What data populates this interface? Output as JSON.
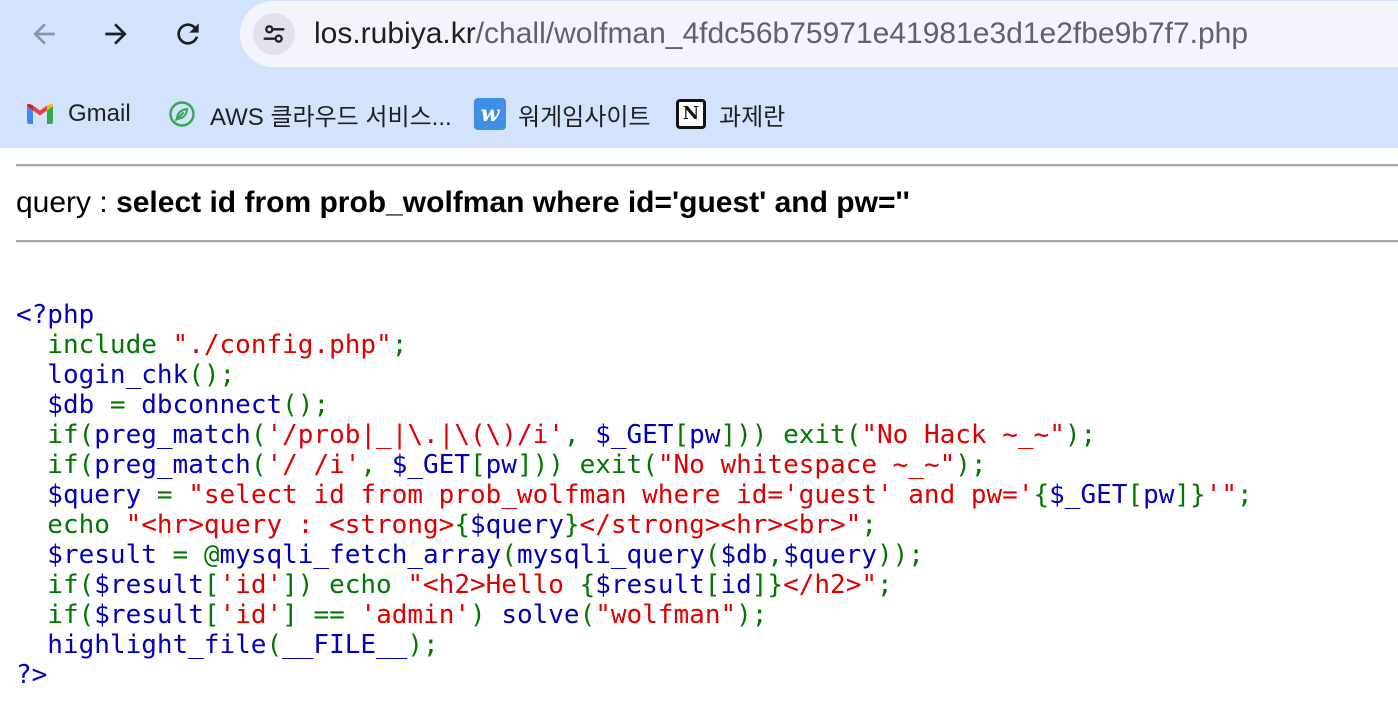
{
  "browser": {
    "nav": {
      "back_icon": "arrow-back-icon",
      "forward_icon": "arrow-forward-icon",
      "reload_icon": "reload-icon"
    },
    "omnibox": {
      "site_info_icon": "tune-icon",
      "url_host": "los.rubiya.kr",
      "url_path": "/chall/wolfman_4fdc56b75971e41981e3d1e2fbe9b7f7.php"
    },
    "bookmarks": [
      {
        "label": "Gmail",
        "icon": "gmail-icon"
      },
      {
        "label": "AWS 클라우드 서비스...",
        "icon": "aws-leaf-icon"
      },
      {
        "label": "워게임사이트",
        "icon": "wargame-w-icon",
        "icon_letter": "w"
      },
      {
        "label": "과제란",
        "icon": "notion-icon",
        "icon_letter": "N"
      }
    ]
  },
  "page": {
    "query_label": "query : ",
    "query_sql": "select id from prob_wolfman where id='guest' and pw=''",
    "source": {
      "lines": [
        [
          {
            "t": "<?php",
            "k": "default"
          }
        ],
        [
          {
            "t": "  include ",
            "k": "keyword"
          },
          {
            "t": "\"./config.php\"",
            "k": "string"
          },
          {
            "t": ";",
            "k": "keyword"
          }
        ],
        [
          {
            "t": "  login_chk",
            "k": "default"
          },
          {
            "t": "();",
            "k": "keyword"
          }
        ],
        [
          {
            "t": "  $db",
            "k": "default"
          },
          {
            "t": " = ",
            "k": "keyword"
          },
          {
            "t": "dbconnect",
            "k": "default"
          },
          {
            "t": "();",
            "k": "keyword"
          }
        ],
        [
          {
            "t": "  if(",
            "k": "keyword"
          },
          {
            "t": "preg_match",
            "k": "default"
          },
          {
            "t": "(",
            "k": "keyword"
          },
          {
            "t": "'/prob|_|\\.|\\(\\)/i'",
            "k": "string"
          },
          {
            "t": ", ",
            "k": "keyword"
          },
          {
            "t": "$_GET",
            "k": "default"
          },
          {
            "t": "[",
            "k": "keyword"
          },
          {
            "t": "pw",
            "k": "default"
          },
          {
            "t": "])) exit(",
            "k": "keyword"
          },
          {
            "t": "\"No Hack ~_~\"",
            "k": "string"
          },
          {
            "t": ");",
            "k": "keyword"
          }
        ],
        [
          {
            "t": "  if(",
            "k": "keyword"
          },
          {
            "t": "preg_match",
            "k": "default"
          },
          {
            "t": "(",
            "k": "keyword"
          },
          {
            "t": "'/ /i'",
            "k": "string"
          },
          {
            "t": ", ",
            "k": "keyword"
          },
          {
            "t": "$_GET",
            "k": "default"
          },
          {
            "t": "[",
            "k": "keyword"
          },
          {
            "t": "pw",
            "k": "default"
          },
          {
            "t": "])) exit(",
            "k": "keyword"
          },
          {
            "t": "\"No whitespace ~_~\"",
            "k": "string"
          },
          {
            "t": ");",
            "k": "keyword"
          }
        ],
        [
          {
            "t": "  $query",
            "k": "default"
          },
          {
            "t": " = ",
            "k": "keyword"
          },
          {
            "t": "\"select id from prob_wolfman where id='guest' and pw='",
            "k": "string"
          },
          {
            "t": "{",
            "k": "keyword"
          },
          {
            "t": "$_GET",
            "k": "default"
          },
          {
            "t": "[",
            "k": "keyword"
          },
          {
            "t": "pw",
            "k": "default"
          },
          {
            "t": "]}",
            "k": "keyword"
          },
          {
            "t": "'\"",
            "k": "string"
          },
          {
            "t": ";",
            "k": "keyword"
          }
        ],
        [
          {
            "t": "  echo ",
            "k": "keyword"
          },
          {
            "t": "\"<hr>query : <strong>",
            "k": "string"
          },
          {
            "t": "{",
            "k": "keyword"
          },
          {
            "t": "$query",
            "k": "default"
          },
          {
            "t": "}",
            "k": "keyword"
          },
          {
            "t": "</strong><hr><br>\"",
            "k": "string"
          },
          {
            "t": ";",
            "k": "keyword"
          }
        ],
        [
          {
            "t": "  $result",
            "k": "default"
          },
          {
            "t": " = @",
            "k": "keyword"
          },
          {
            "t": "mysqli_fetch_array",
            "k": "default"
          },
          {
            "t": "(",
            "k": "keyword"
          },
          {
            "t": "mysqli_query",
            "k": "default"
          },
          {
            "t": "(",
            "k": "keyword"
          },
          {
            "t": "$db",
            "k": "default"
          },
          {
            "t": ",",
            "k": "keyword"
          },
          {
            "t": "$query",
            "k": "default"
          },
          {
            "t": "));",
            "k": "keyword"
          }
        ],
        [
          {
            "t": "  if(",
            "k": "keyword"
          },
          {
            "t": "$result",
            "k": "default"
          },
          {
            "t": "[",
            "k": "keyword"
          },
          {
            "t": "'id'",
            "k": "string"
          },
          {
            "t": "]) echo ",
            "k": "keyword"
          },
          {
            "t": "\"<h2>Hello ",
            "k": "string"
          },
          {
            "t": "{",
            "k": "keyword"
          },
          {
            "t": "$result",
            "k": "default"
          },
          {
            "t": "[",
            "k": "keyword"
          },
          {
            "t": "id",
            "k": "default"
          },
          {
            "t": "]}",
            "k": "keyword"
          },
          {
            "t": "</h2>\"",
            "k": "string"
          },
          {
            "t": ";",
            "k": "keyword"
          }
        ],
        [
          {
            "t": "  if(",
            "k": "keyword"
          },
          {
            "t": "$result",
            "k": "default"
          },
          {
            "t": "[",
            "k": "keyword"
          },
          {
            "t": "'id'",
            "k": "string"
          },
          {
            "t": "] == ",
            "k": "keyword"
          },
          {
            "t": "'admin'",
            "k": "string"
          },
          {
            "t": ") ",
            "k": "keyword"
          },
          {
            "t": "solve",
            "k": "default"
          },
          {
            "t": "(",
            "k": "keyword"
          },
          {
            "t": "\"wolfman\"",
            "k": "string"
          },
          {
            "t": ");",
            "k": "keyword"
          }
        ],
        [
          {
            "t": "  highlight_file",
            "k": "default"
          },
          {
            "t": "(",
            "k": "keyword"
          },
          {
            "t": "__FILE__",
            "k": "default"
          },
          {
            "t": ");",
            "k": "keyword"
          }
        ],
        [
          {
            "t": "?>",
            "k": "default"
          }
        ]
      ]
    }
  },
  "colors": {
    "toolbar": "#d3e3fd",
    "omnibox": "#f2f5fb",
    "url_host": "#1f1f1f",
    "url_path": "#5f6368",
    "back_disabled": "#8a94a6",
    "php_default": "#0000BB",
    "php_keyword": "#007700",
    "php_string": "#DD0000"
  }
}
